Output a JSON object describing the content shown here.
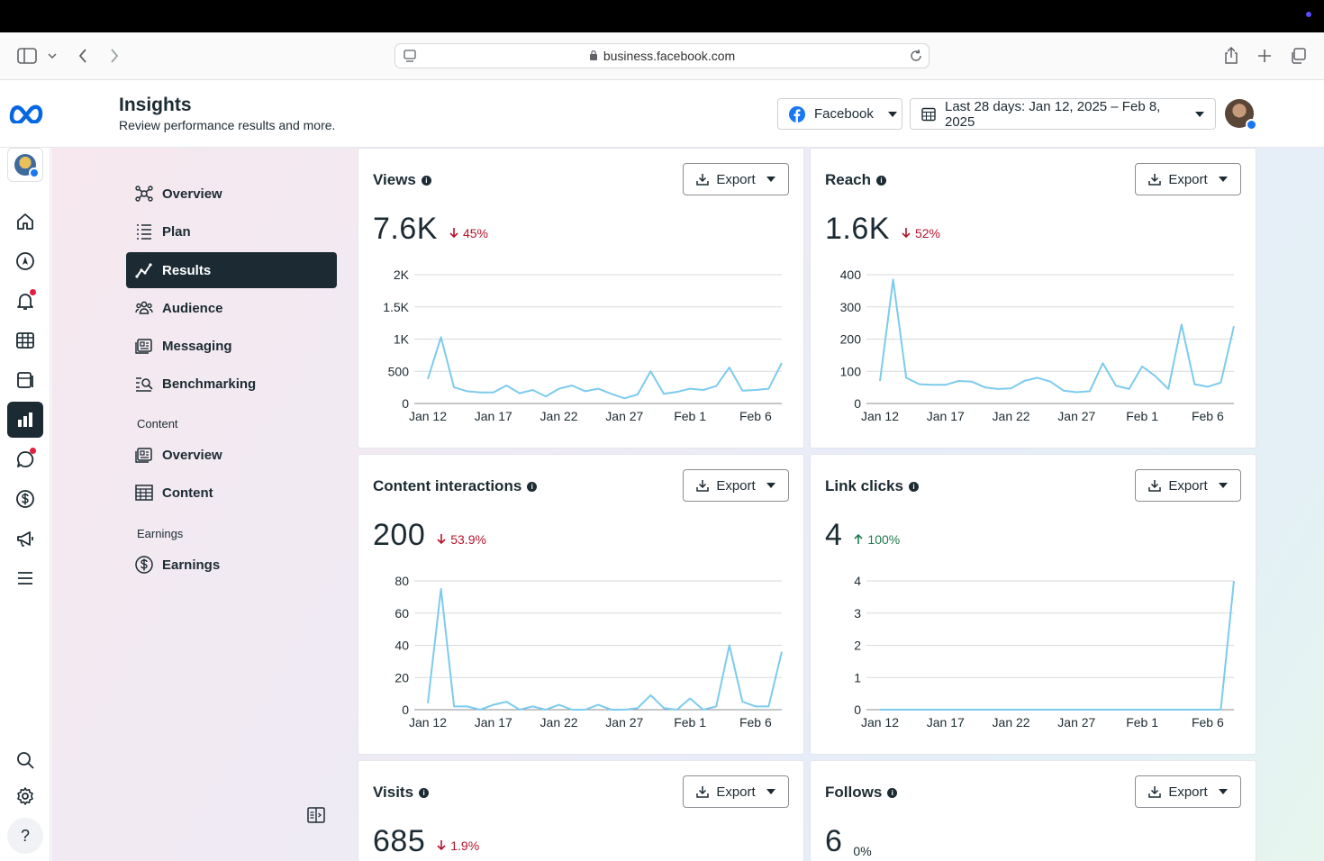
{
  "browser": {
    "url": "business.facebook.com"
  },
  "header": {
    "title": "Insights",
    "subtitle": "Review performance results and more.",
    "platform_label": "Facebook",
    "date_range_label": "Last 28 days: Jan 12, 2025 – Feb 8, 2025"
  },
  "sidenav": {
    "items": [
      {
        "label": "Overview",
        "icon": "network-icon"
      },
      {
        "label": "Plan",
        "icon": "list-icon"
      },
      {
        "label": "Results",
        "icon": "trend-icon",
        "active": true
      },
      {
        "label": "Audience",
        "icon": "people-icon"
      },
      {
        "label": "Messaging",
        "icon": "messaging-icon"
      },
      {
        "label": "Benchmarking",
        "icon": "benchmark-icon"
      }
    ],
    "content_section": "Content",
    "content_items": [
      {
        "label": "Overview",
        "icon": "content-overview-icon"
      },
      {
        "label": "Content",
        "icon": "table-icon"
      }
    ],
    "earnings_section": "Earnings",
    "earnings_items": [
      {
        "label": "Earnings",
        "icon": "dollar-icon"
      }
    ]
  },
  "export_label": "Export",
  "colors": {
    "line": "#7ccbee",
    "down": "#b3152d",
    "up": "#1f7a4e",
    "dark": "#1c2b33"
  },
  "cards": [
    {
      "title": "Views",
      "value": "7.6K",
      "change": "45%",
      "direction": "down"
    },
    {
      "title": "Reach",
      "value": "1.6K",
      "change": "52%",
      "direction": "down"
    },
    {
      "title": "Content interactions",
      "value": "200",
      "change": "53.9%",
      "direction": "down"
    },
    {
      "title": "Link clicks",
      "value": "4",
      "change": "100%",
      "direction": "up"
    },
    {
      "title": "Visits",
      "value": "685",
      "change": "1.9%",
      "direction": "down"
    },
    {
      "title": "Follows",
      "value": "6",
      "change": "0%",
      "direction": "flat"
    }
  ],
  "chart_data": [
    {
      "type": "line",
      "title": "Views",
      "x_tick_labels": [
        "Jan 12",
        "Jan 17",
        "Jan 22",
        "Jan 27",
        "Feb 1",
        "Feb 6"
      ],
      "y_tick_labels": [
        "0",
        "500",
        "1K",
        "1.5K",
        "2K"
      ],
      "ylim": [
        0,
        2000
      ],
      "series": [
        {
          "values": [
            380,
            1030,
            250,
            190,
            170,
            170,
            280,
            160,
            210,
            110,
            230,
            280,
            190,
            230,
            150,
            80,
            140,
            500,
            150,
            180,
            230,
            210,
            270,
            560,
            200,
            210,
            230,
            630
          ]
        }
      ]
    },
    {
      "type": "line",
      "title": "Reach",
      "x_tick_labels": [
        "Jan 12",
        "Jan 17",
        "Jan 22",
        "Jan 27",
        "Feb 1",
        "Feb 6"
      ],
      "y_tick_labels": [
        "0",
        "100",
        "200",
        "300",
        "400"
      ],
      "ylim": [
        0,
        400
      ],
      "series": [
        {
          "values": [
            70,
            385,
            80,
            60,
            58,
            58,
            70,
            68,
            50,
            45,
            47,
            70,
            80,
            68,
            40,
            35,
            38,
            125,
            55,
            45,
            115,
            85,
            45,
            245,
            60,
            52,
            65,
            240
          ]
        }
      ]
    },
    {
      "type": "line",
      "title": "Content interactions",
      "x_tick_labels": [
        "Jan 12",
        "Jan 17",
        "Jan 22",
        "Jan 27",
        "Feb 1",
        "Feb 6"
      ],
      "y_tick_labels": [
        "0",
        "20",
        "40",
        "60",
        "80"
      ],
      "ylim": [
        0,
        80
      ],
      "series": [
        {
          "values": [
            4,
            75,
            2,
            2,
            0,
            3,
            5,
            0,
            2,
            0,
            3,
            0,
            0,
            3,
            0,
            0,
            1,
            9,
            1,
            0,
            7,
            0,
            2,
            40,
            5,
            2,
            2,
            36
          ]
        }
      ]
    },
    {
      "type": "line",
      "title": "Link clicks",
      "x_tick_labels": [
        "Jan 12",
        "Jan 17",
        "Jan 22",
        "Jan 27",
        "Feb 1",
        "Feb 6"
      ],
      "y_tick_labels": [
        "0",
        "1",
        "2",
        "3",
        "4"
      ],
      "ylim": [
        0,
        4
      ],
      "series": [
        {
          "values": [
            0,
            0,
            0,
            0,
            0,
            0,
            0,
            0,
            0,
            0,
            0,
            0,
            0,
            0,
            0,
            0,
            0,
            0,
            0,
            0,
            0,
            0,
            0,
            0,
            0,
            0,
            0,
            4
          ]
        }
      ]
    }
  ]
}
